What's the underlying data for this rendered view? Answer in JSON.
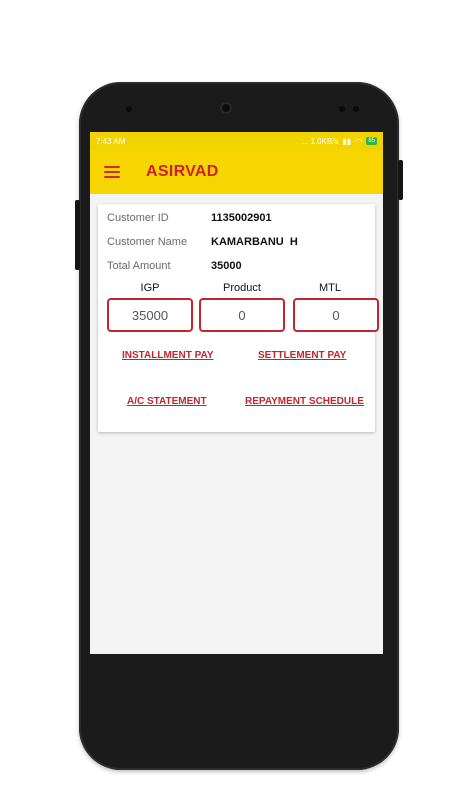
{
  "statusbar": {
    "time": "7:43 AM",
    "right_text": "... 1.0KB/s",
    "battery": "85"
  },
  "app": {
    "title": "ASIRVAD"
  },
  "customer": {
    "id_label": "Customer ID",
    "id_value": "1135002901",
    "name_label": "Customer Name",
    "name_value": "KAMARBANU  H",
    "amount_label": "Total Amount",
    "amount_value": "35000"
  },
  "columns": [
    {
      "head": "IGP",
      "value": "35000"
    },
    {
      "head": "Product",
      "value": "0"
    },
    {
      "head": "MTL",
      "value": "0"
    }
  ],
  "links": {
    "installment_pay": "INSTALLMENT PAY",
    "settlement_pay": "SETTLEMENT PAY",
    "ac_statement": "A/C STATEMENT",
    "repayment_schedule": "REPAYMENT SCHEDULE"
  },
  "colors": {
    "accent_yellow": "#f6d500",
    "brand_red": "#d11f27"
  }
}
